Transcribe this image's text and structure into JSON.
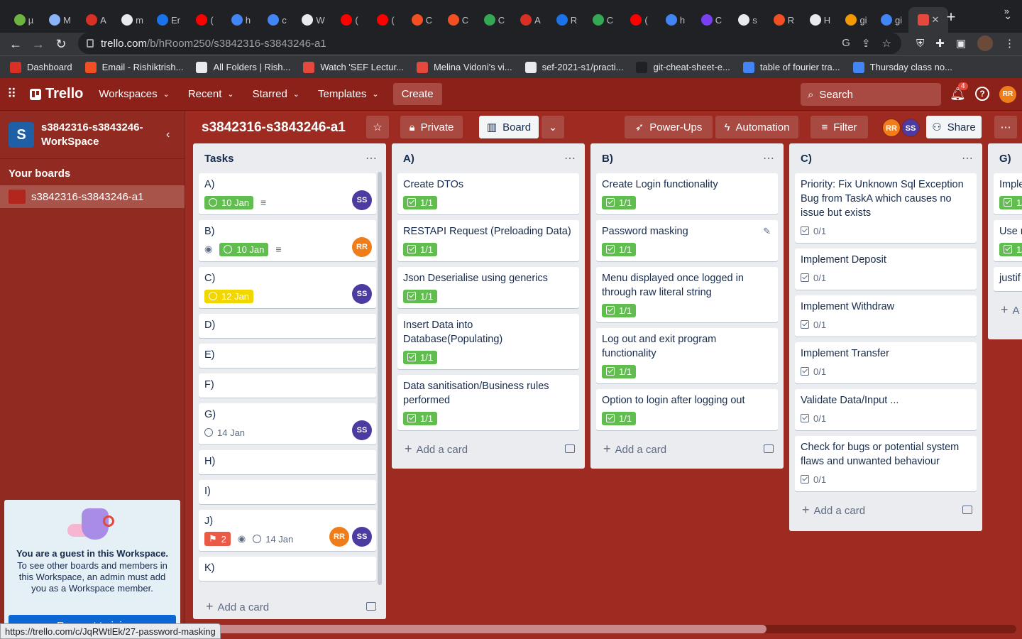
{
  "browser": {
    "tabs": [
      {
        "label": "µ",
        "color": "#6db33f"
      },
      {
        "label": "M",
        "color": "#8ab4f8"
      },
      {
        "label": "A",
        "color": "#d93025"
      },
      {
        "label": "m",
        "color": "#e8eaed"
      },
      {
        "label": "Er",
        "color": "#1a73e8"
      },
      {
        "label": "(",
        "color": "#ff0000"
      },
      {
        "label": "h",
        "color": "#4285f4"
      },
      {
        "label": "c",
        "color": "#4285f4"
      },
      {
        "label": "W",
        "color": "#e8eaed"
      },
      {
        "label": "(",
        "color": "#ff0000"
      },
      {
        "label": "(",
        "color": "#ff0000"
      },
      {
        "label": "C",
        "color": "#f25022"
      },
      {
        "label": "C",
        "color": "#f25022"
      },
      {
        "label": "C",
        "color": "#34a853"
      },
      {
        "label": "A",
        "color": "#d93025"
      },
      {
        "label": "R",
        "color": "#1a73e8"
      },
      {
        "label": "C",
        "color": "#34a853"
      },
      {
        "label": "(",
        "color": "#ff0000"
      },
      {
        "label": "h",
        "color": "#4285f4"
      },
      {
        "label": "C",
        "color": "#7b3ff2"
      },
      {
        "label": "s",
        "color": "#e8eaed"
      },
      {
        "label": "R",
        "color": "#f25022"
      },
      {
        "label": "H",
        "color": "#e8eaed"
      },
      {
        "label": "gi",
        "color": "#f29900"
      },
      {
        "label": "gi",
        "color": "#4285f4"
      }
    ],
    "active_tab_close": "✕",
    "new_tab": "+",
    "tab_menu": "⌄",
    "url_host": "trello.com",
    "url_path": "/b/hRoom250/s3842316-s3843246-a1",
    "bookmarks": [
      {
        "label": "Dashboard",
        "color": "#d93025"
      },
      {
        "label": "Email - Rishiktrish...",
        "color": "#f25022"
      },
      {
        "label": "All Folders | Rish...",
        "color": "#e8eaed"
      },
      {
        "label": "Watch 'SEF Lectur...",
        "color": "#e5483d"
      },
      {
        "label": "Melina Vidoni's vi...",
        "color": "#e5483d"
      },
      {
        "label": "sef-2021-s1/practi...",
        "color": "#e8eaed"
      },
      {
        "label": "git-cheat-sheet-e...",
        "color": "#202124"
      },
      {
        "label": "table of fourier tra...",
        "color": "#4285f4"
      },
      {
        "label": "Thursday class no...",
        "color": "#4285f4"
      }
    ],
    "bookmarks_more": "»",
    "status_url": "https://trello.com/c/JqRWtlEk/27-password-masking"
  },
  "header": {
    "logo": "Trello",
    "nav": [
      "Workspaces",
      "Recent",
      "Starred",
      "Templates"
    ],
    "create": "Create",
    "search_placeholder": "Search",
    "notif_count": "4",
    "help": "?",
    "avatar": "RR"
  },
  "sidebar": {
    "ws_initial": "S",
    "ws_name": "s3842316-s3843246-WorkSpace",
    "your_boards": "Your boards",
    "board_name": "s3842316-s3843246-a1",
    "guest_title": "You are a guest in this Workspace.",
    "guest_text": "To see other boards and members in this Workspace, an admin must add you as a Workspace member.",
    "join_button": "Request to join"
  },
  "board": {
    "title": "s3842316-s3843246-a1",
    "private": "Private",
    "view": "Board",
    "powerups": "Power-Ups",
    "automation": "Automation",
    "filter": "Filter",
    "members": [
      "RR",
      "SS"
    ],
    "share": "Share"
  },
  "lists": [
    {
      "title": "Tasks",
      "cards": [
        {
          "title": "A)",
          "date": "10 Jan",
          "date_style": "green",
          "desc": true,
          "members": [
            "SS"
          ]
        },
        {
          "title": "B)",
          "watch": true,
          "date": "10 Jan",
          "date_style": "green",
          "desc": true,
          "members": [
            "RR"
          ]
        },
        {
          "title": "C)",
          "date": "12 Jan",
          "date_style": "yellow",
          "members": [
            "SS"
          ]
        },
        {
          "title": "D)"
        },
        {
          "title": "E)"
        },
        {
          "title": "F)"
        },
        {
          "title": "G)",
          "date": "14 Jan",
          "date_style": "plain",
          "members": [
            "SS"
          ]
        },
        {
          "title": "H)"
        },
        {
          "title": "I)"
        },
        {
          "title": "J)",
          "votes": "2",
          "watch": true,
          "date": "14 Jan",
          "date_style": "plain",
          "members": [
            "RR",
            "SS"
          ]
        },
        {
          "title": "K)"
        }
      ],
      "add": "Add a card"
    },
    {
      "title": "A)",
      "cards": [
        {
          "title": "Create DTOs",
          "check": "1/1",
          "check_style": "green"
        },
        {
          "title": "RESTAPI Request (Preloading Data)",
          "check": "1/1",
          "check_style": "green"
        },
        {
          "title": "Json Deserialise using generics",
          "check": "1/1",
          "check_style": "green"
        },
        {
          "title": "Insert Data into Database(Populating)",
          "check": "1/1",
          "check_style": "green"
        },
        {
          "title": "Data sanitisation/Business rules performed",
          "check": "1/1",
          "check_style": "green"
        }
      ],
      "add": "Add a card"
    },
    {
      "title": "B)",
      "cards": [
        {
          "title": "Create Login functionality",
          "check": "1/1",
          "check_style": "green"
        },
        {
          "title": "Password masking",
          "check": "1/1",
          "check_style": "green",
          "edit": true
        },
        {
          "title": "Menu displayed once logged in through raw literal string",
          "check": "1/1",
          "check_style": "green"
        },
        {
          "title": "Log out and exit program functionality",
          "check": "1/1",
          "check_style": "green"
        },
        {
          "title": "Option to login after logging out",
          "check": "1/1",
          "check_style": "green"
        }
      ],
      "add": "Add a card"
    },
    {
      "title": "C)",
      "cards": [
        {
          "title": "Priority: Fix Unknown Sql Exception Bug from TaskA which causes no issue but exists",
          "check": "0/1",
          "check_style": "plain"
        },
        {
          "title": "Implement Deposit",
          "check": "0/1",
          "check_style": "plain"
        },
        {
          "title": "Implement Withdraw",
          "check": "0/1",
          "check_style": "plain"
        },
        {
          "title": "Implement Transfer",
          "check": "0/1",
          "check_style": "plain"
        },
        {
          "title": "Validate Data/Input ...",
          "check": "0/1",
          "check_style": "plain"
        },
        {
          "title": "Check for bugs or potential system flaws and unwanted behaviour",
          "check": "0/1",
          "check_style": "plain"
        }
      ],
      "add": "Add a card"
    },
    {
      "title": "G)",
      "cards": [
        {
          "title": "Imple",
          "check": "1/",
          "check_style": "green"
        },
        {
          "title": "Use r Proje",
          "check": "1/",
          "check_style": "green"
        },
        {
          "title": "justif"
        }
      ],
      "add": "A"
    }
  ]
}
